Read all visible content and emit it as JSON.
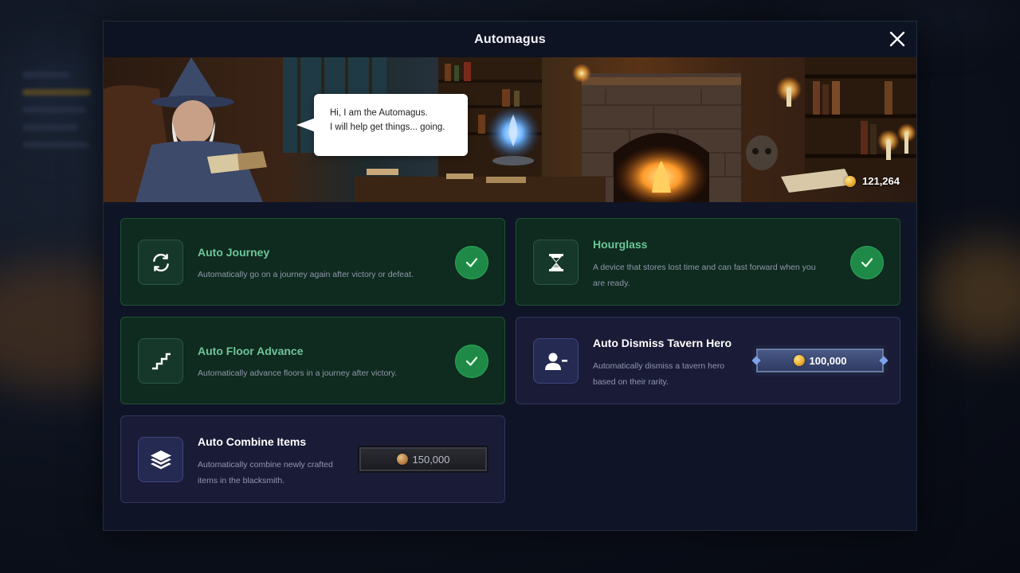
{
  "modal": {
    "title": "Automagus"
  },
  "banner": {
    "speech_line1": "Hi, I am the Automagus.",
    "speech_line2": "I will help get things... going.",
    "gold": "121,264"
  },
  "upgrades": [
    {
      "title": "Auto Journey",
      "description": "Automatically go on a journey again after victory or defeat.",
      "owned": true,
      "icon": "refresh-icon"
    },
    {
      "title": "Hourglass",
      "description_line1": "A device that stores lost time and can fast forward when you",
      "description_line2": "are ready.",
      "owned": true,
      "icon": "hourglass-icon"
    },
    {
      "title": "Auto Floor Advance",
      "description": "Automatically advance floors in a journey after victory.",
      "owned": true,
      "icon": "stairs-icon"
    },
    {
      "title": "Auto Dismiss Tavern Hero",
      "description_line1": "Automatically dismiss a tavern hero",
      "description_line2": "based on their rarity.",
      "owned": false,
      "price": "100,000",
      "icon": "remove-user-icon"
    },
    {
      "title": "Auto Combine Items",
      "description_line1": "Automatically combine newly crafted",
      "description_line2": "items in the blacksmith.",
      "owned": false,
      "price": "150,000",
      "icon": "layers-icon"
    }
  ],
  "colors": {
    "owned_accent": "#6cc79a",
    "check_green": "#1f8a48",
    "modal_bg": "#0f1526"
  }
}
